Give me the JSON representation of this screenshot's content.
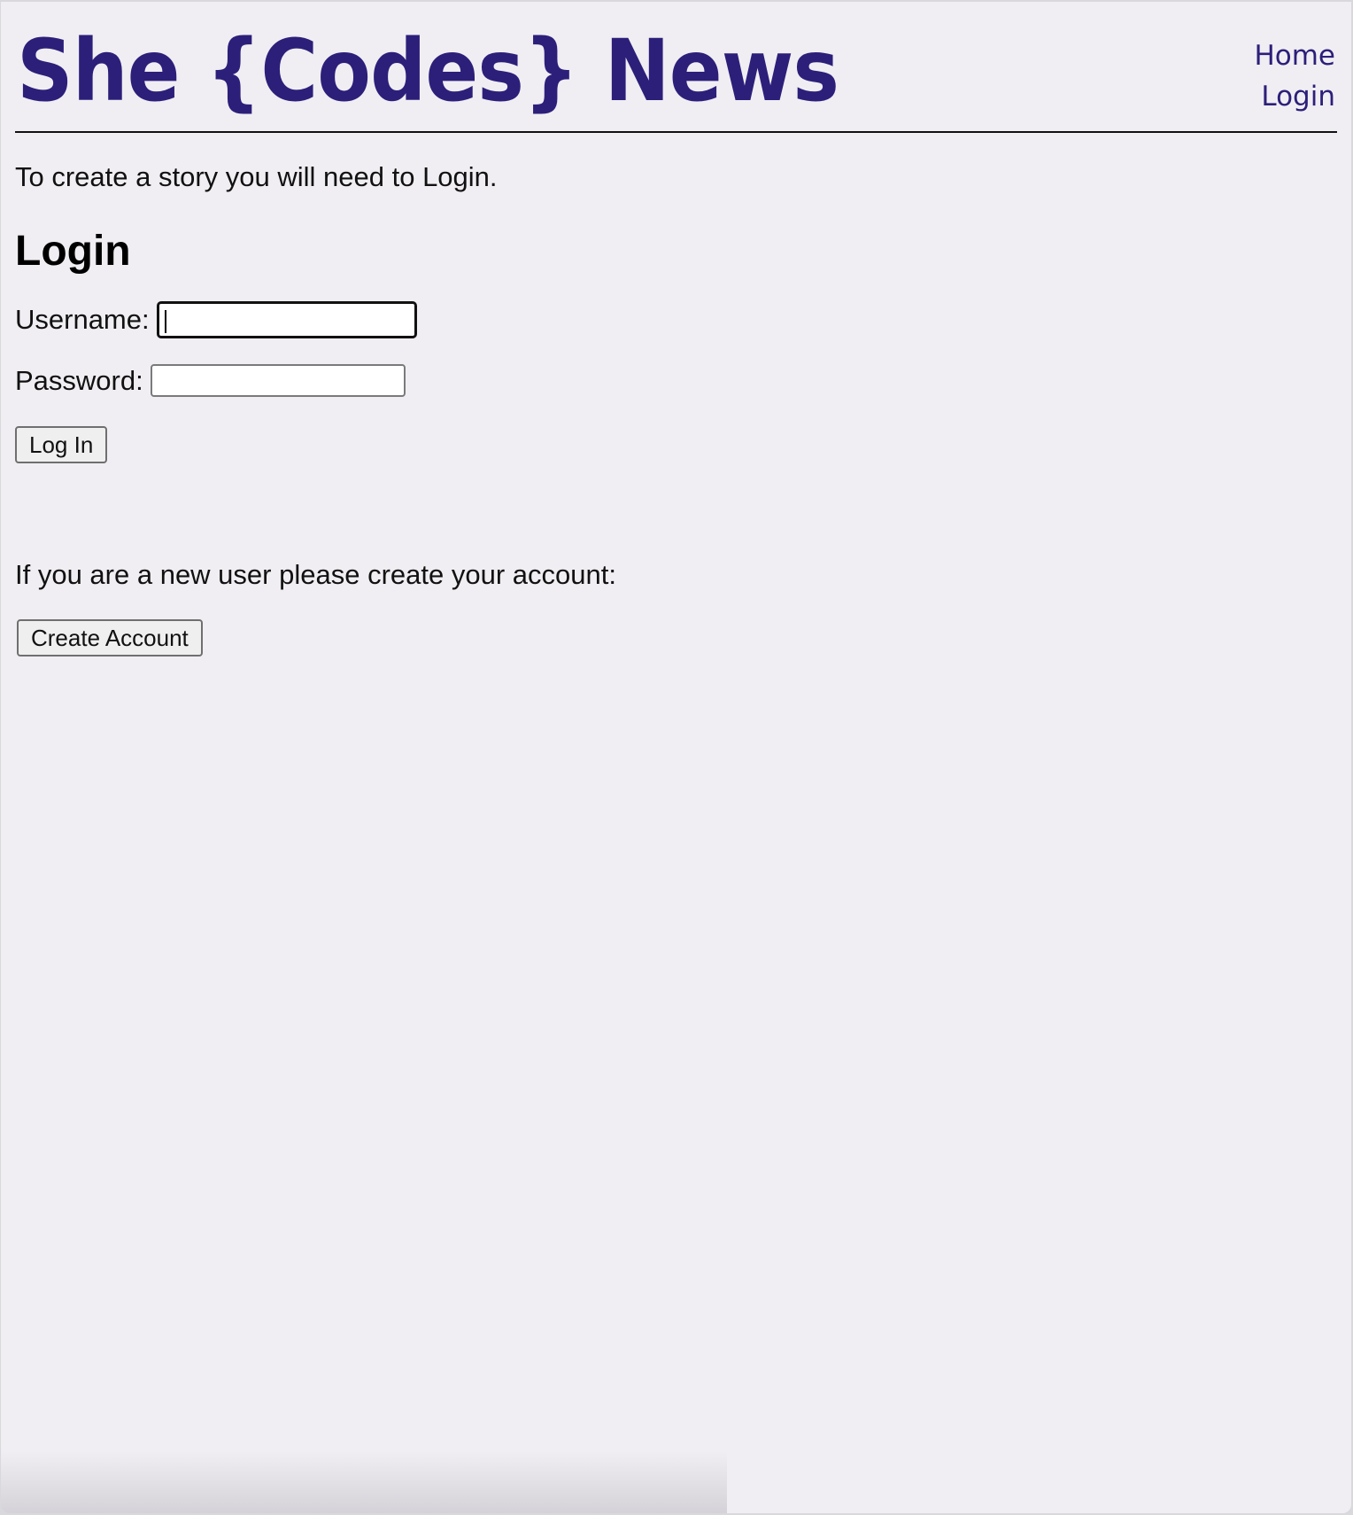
{
  "header": {
    "site_title": "She {Codes} News",
    "nav": {
      "home": "Home",
      "login": "Login"
    }
  },
  "main": {
    "intro_text": "To create a story you will need to Login.",
    "login_heading": "Login",
    "form": {
      "username_label": "Username:",
      "username_value": "",
      "password_label": "Password:",
      "password_value": "",
      "submit_label": "Log In"
    },
    "new_user_text": "If you are a new user please create your account:",
    "create_account_label": "Create Account"
  },
  "colors": {
    "brand": "#2c1f7a",
    "background": "#f0eef2",
    "text": "#111111"
  }
}
